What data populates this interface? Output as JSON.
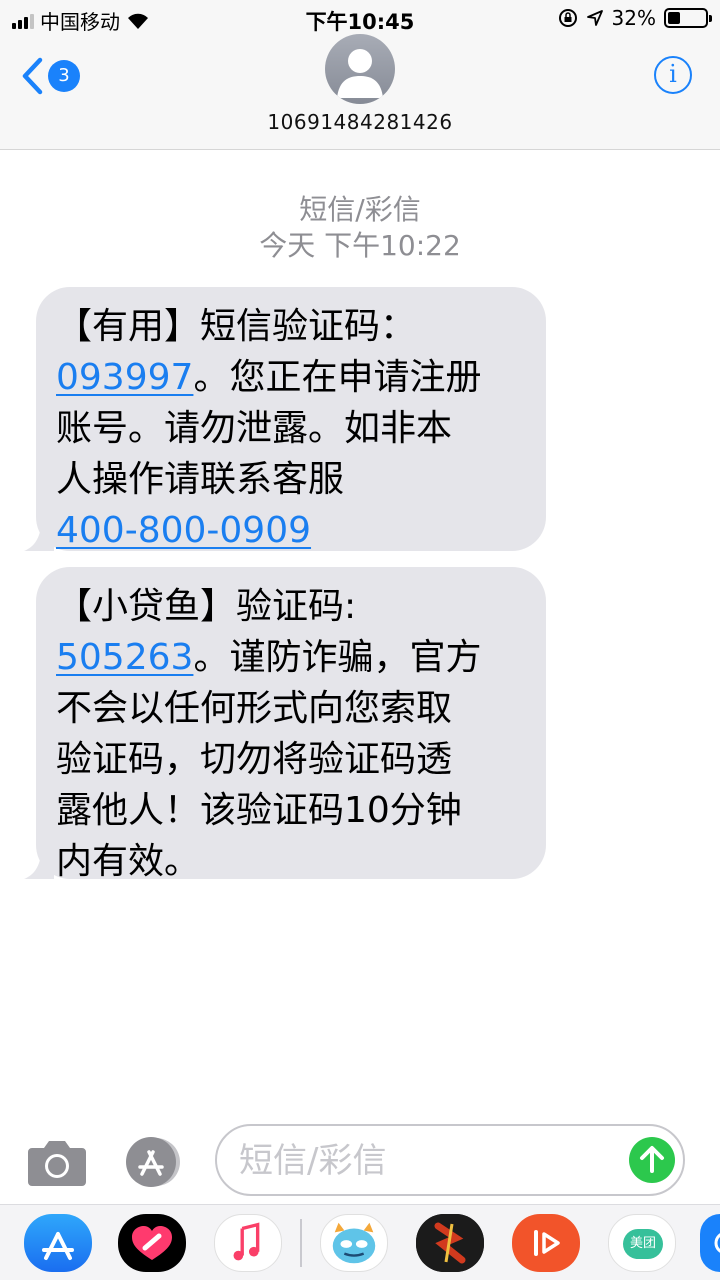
{
  "status_bar": {
    "carrier": "中国移动",
    "time": "下午10:45",
    "battery_percent": "32%",
    "battery_level": 0.32
  },
  "header": {
    "back_badge_count": "3",
    "contact_name": "10691484281426",
    "info_glyph": "i"
  },
  "conversation": {
    "type_label": "短信/彩信",
    "timestamp": "今天 下午10:22"
  },
  "messages": [
    {
      "line1": "【有用】短信验证码：",
      "code": "093997",
      "line2_rest": "。您正在申请注册",
      "line3": "账号。请勿泄露。如非本",
      "line4": "人操作请联系客服",
      "phone": "400-800-0909"
    },
    {
      "line1": "【小贷鱼】验证码:",
      "code": "505263",
      "line2_rest": "。谨防诈骗，官方",
      "line3": "不会以任何形式向您索取",
      "line4": "验证码，切勿将验证码透",
      "line5": "露他人！该验证码10分钟",
      "line6": "内有效。"
    }
  ],
  "input": {
    "placeholder": "短信/彩信"
  },
  "drawer": {
    "meituan_label": "美团"
  },
  "colors": {
    "accent": "#1a82fb",
    "bubble": "#e5e5ea",
    "send": "#2cc84d",
    "meta_text": "#8e8e93"
  }
}
